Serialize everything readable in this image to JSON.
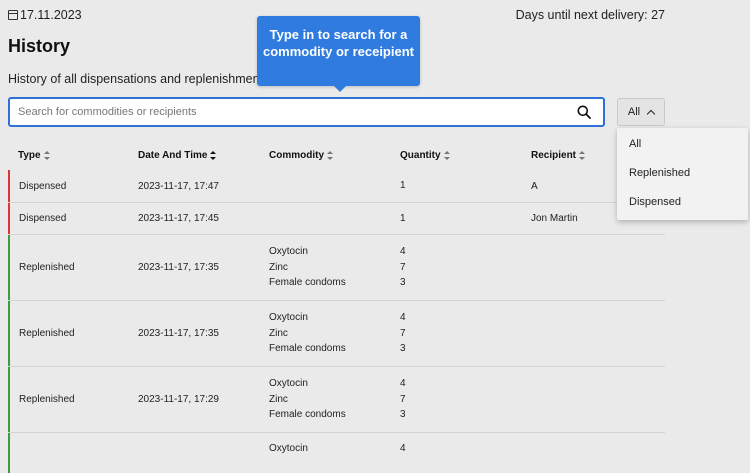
{
  "header": {
    "date": "17.11.2023",
    "delivery_text": "Days until next delivery: 27"
  },
  "page": {
    "title": "History",
    "subtitle": "History of all dispensations and replenishments"
  },
  "tooltip": {
    "text": "Type in to search for a commodity or receipient"
  },
  "search": {
    "placeholder": "Search for commodities or recipients",
    "value": ""
  },
  "filter": {
    "selected": "All",
    "options": [
      "All",
      "Replenished",
      "Dispensed"
    ]
  },
  "table": {
    "columns": [
      "Type",
      "Date And Time",
      "Commodity",
      "Quantity",
      "Recipient"
    ],
    "rows": [
      {
        "type": "Dispensed",
        "datetime": "2023-11-17, 17:47",
        "commodities": [],
        "quantities": [
          "1"
        ],
        "recipient": "A"
      },
      {
        "type": "Dispensed",
        "datetime": "2023-11-17, 17:45",
        "commodities": [],
        "quantities": [
          "1"
        ],
        "recipient": "Jon Martin"
      },
      {
        "type": "Replenished",
        "datetime": "2023-11-17, 17:35",
        "commodities": [
          "Oxytocin",
          "Zinc",
          "Female condoms"
        ],
        "quantities": [
          "4",
          "7",
          "3"
        ],
        "recipient": ""
      },
      {
        "type": "Replenished",
        "datetime": "2023-11-17, 17:35",
        "commodities": [
          "Oxytocin",
          "Zinc",
          "Female condoms"
        ],
        "quantities": [
          "4",
          "7",
          "3"
        ],
        "recipient": ""
      },
      {
        "type": "Replenished",
        "datetime": "2023-11-17, 17:29",
        "commodities": [
          "Oxytocin",
          "Zinc",
          "Female condoms"
        ],
        "quantities": [
          "4",
          "7",
          "3"
        ],
        "recipient": ""
      },
      {
        "type": "",
        "datetime": "",
        "commodities": [
          "Oxytocin"
        ],
        "quantities": [
          "4"
        ],
        "recipient": ""
      }
    ]
  },
  "colors": {
    "accent": "#2f7be0",
    "dispensed": "#d93838",
    "replenished": "#3d9a3d"
  }
}
